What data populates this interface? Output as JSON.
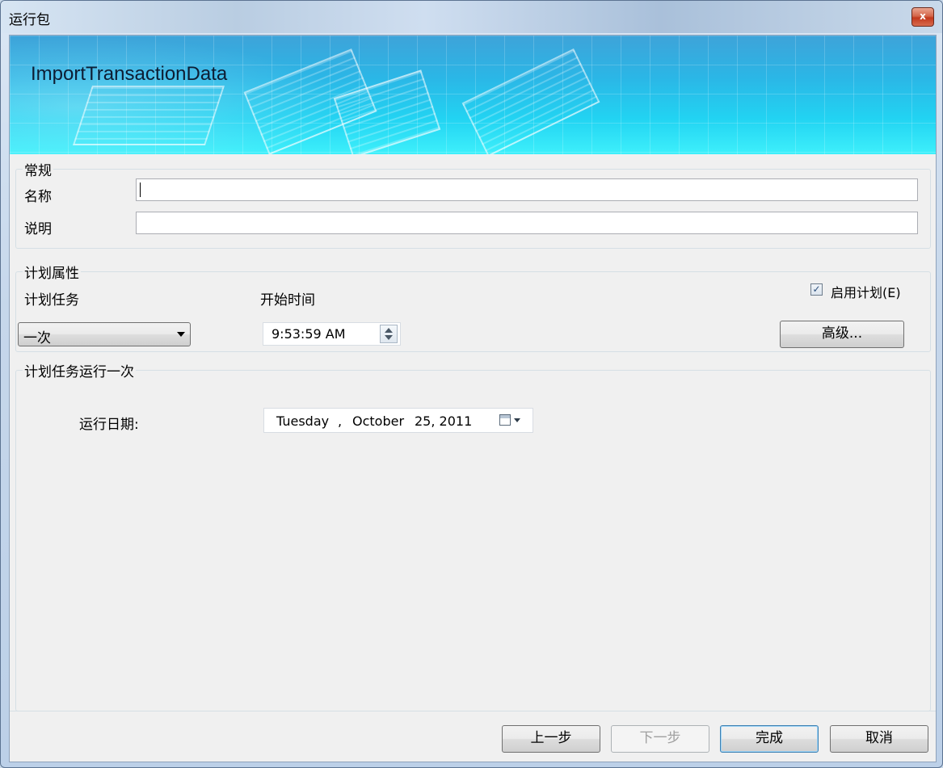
{
  "window": {
    "title": "运行包",
    "close_glyph": "x"
  },
  "banner": {
    "title": "ImportTransactionData"
  },
  "general": {
    "legend": "常规",
    "name_label": "名称",
    "name_value": "",
    "description_label": "说明",
    "description_value": ""
  },
  "schedule": {
    "legend": "计划属性",
    "task_label": "计划任务",
    "task_value": "一次",
    "start_time_label": "开始时间",
    "start_time_value": "9:53:59 AM",
    "enable_label": "启用计划(E)",
    "enable_checked": true,
    "advanced_button": "高级..."
  },
  "run_once": {
    "legend": "计划任务运行一次",
    "run_date_label": "运行日期:",
    "date": {
      "weekday": "Tuesday",
      "sep": ",",
      "month": "October",
      "day_year": "25, 2011"
    }
  },
  "footer": {
    "back_button": "上一步",
    "next_button": "下一步",
    "finish_button": "完成",
    "cancel_button": "取消"
  },
  "colors": {
    "banner_top": "#3ea3d9",
    "banner_bottom": "#3ef0fb",
    "dialog_bg": "#f0f0f0"
  },
  "icons": [
    "close-icon",
    "dropdown-arrow-icon",
    "spinner-icon",
    "checkbox-check-icon",
    "calendar-icon"
  ]
}
